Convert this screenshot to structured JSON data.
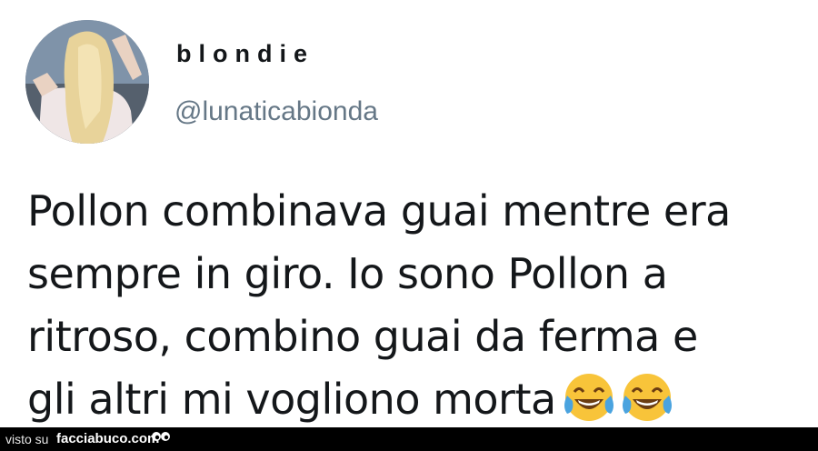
{
  "user": {
    "display_name": "blondie",
    "handle": "@lunaticabionda"
  },
  "tweet": {
    "lines": [
      "Pollon combinava guai mentre era",
      "sempre in giro. Io sono Pollon a",
      "ritroso, combino guai da ferma e",
      "gli altri mi vogliono morta"
    ],
    "emojis": [
      "face-with-tears-of-joy-icon",
      "face-with-tears-of-joy-icon"
    ]
  },
  "footer": {
    "prefix": "visto su",
    "site": "facciabuco.com"
  }
}
